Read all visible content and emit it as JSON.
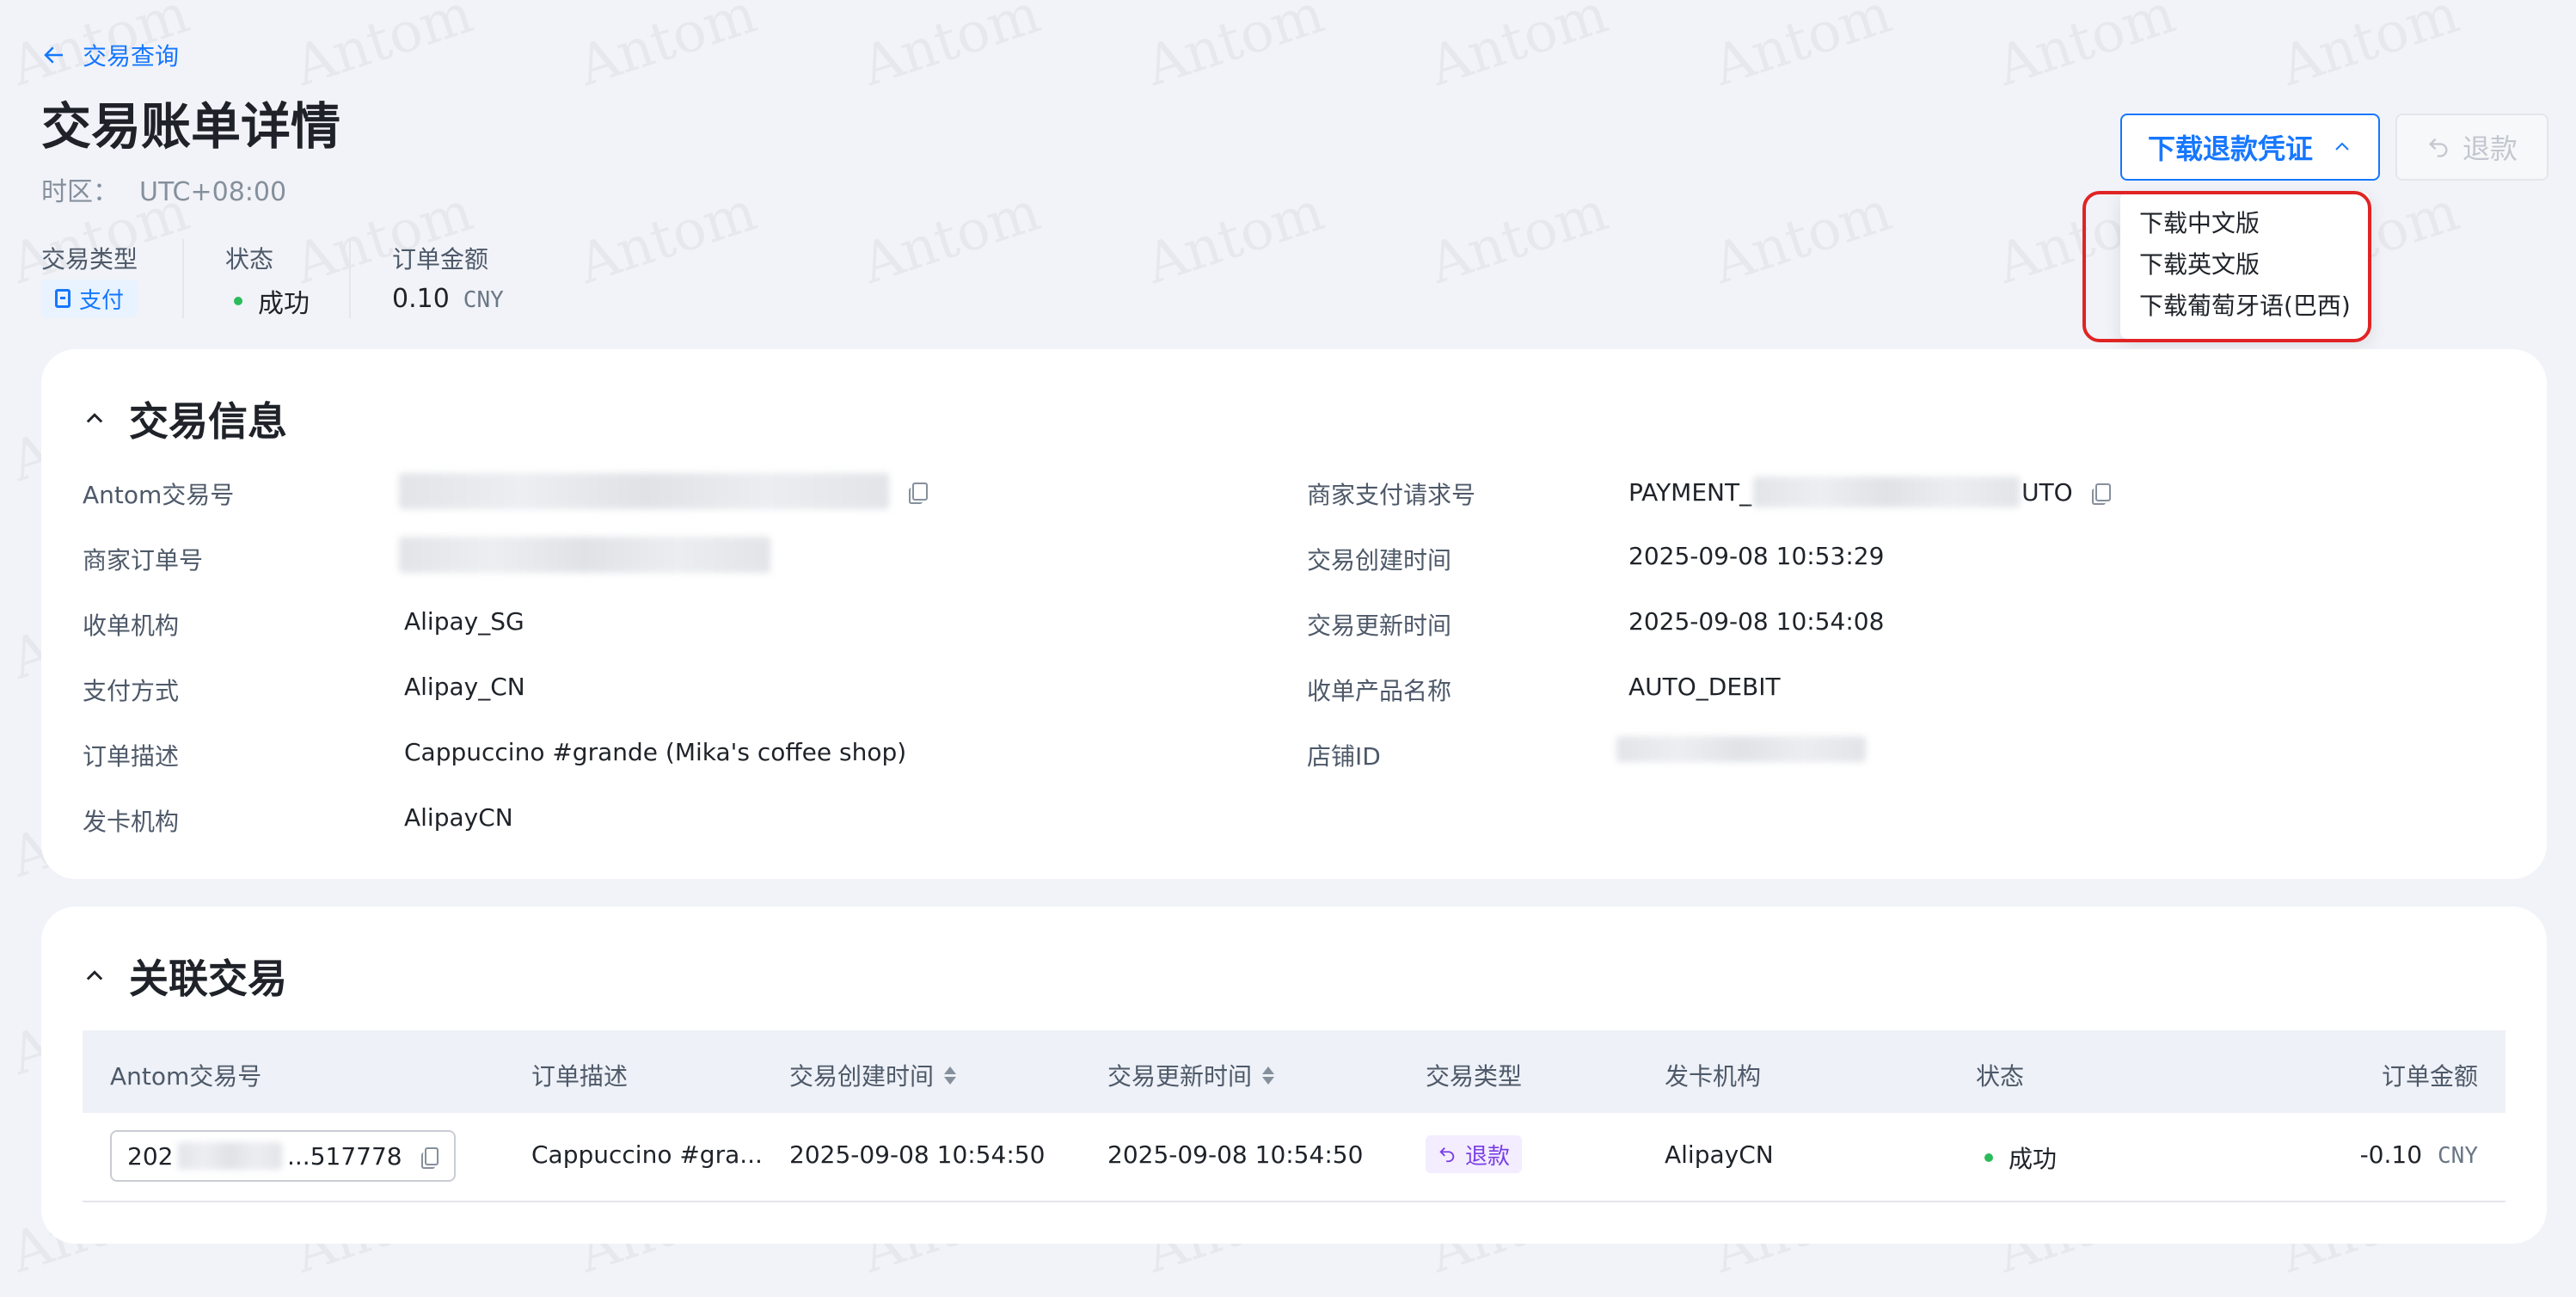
{
  "watermark": {
    "text": "Antom"
  },
  "header": {
    "back_label": "交易查询",
    "title": "交易账单详情",
    "timezone_label": "时区：",
    "timezone_value": "UTC+08:00"
  },
  "summary": {
    "type_label": "交易类型",
    "type_value": "支付",
    "status_label": "状态",
    "status_value": "成功",
    "amount_label": "订单金额",
    "amount_value": "0.10",
    "amount_currency": "CNY"
  },
  "actions": {
    "download_label": "下载退款凭证",
    "refund_label": "退款",
    "download_options": [
      "下载中文版",
      "下载英文版",
      "下载葡萄牙语(巴西)"
    ]
  },
  "tx_info": {
    "title": "交易信息",
    "left": [
      {
        "label": "Antom交易号",
        "value": ""
      },
      {
        "label": "商家订单号",
        "value": ""
      },
      {
        "label": "收单机构",
        "value": "Alipay_SG"
      },
      {
        "label": "支付方式",
        "value": "Alipay_CN"
      },
      {
        "label": "订单描述",
        "value": "Cappuccino #grande (Mika's coffee shop)"
      },
      {
        "label": "发卡机构",
        "value": "AlipayCN"
      }
    ],
    "right": [
      {
        "label": "商家支付请求号",
        "value_prefix": "PAYMENT_",
        "value_suffix": "UTO"
      },
      {
        "label": "交易创建时间",
        "value": "2025-09-08 10:53:29"
      },
      {
        "label": "交易更新时间",
        "value": "2025-09-08 10:54:08"
      },
      {
        "label": "收单产品名称",
        "value": "AUTO_DEBIT"
      },
      {
        "label": "店铺ID",
        "value": ""
      }
    ]
  },
  "related": {
    "title": "关联交易",
    "columns": [
      "Antom交易号",
      "订单描述",
      "交易创建时间",
      "交易更新时间",
      "交易类型",
      "发卡机构",
      "状态",
      "订单金额"
    ],
    "rows": [
      {
        "id_prefix": "202",
        "id_suffix": "...517778",
        "description": "Cappuccino #gra...",
        "created": "2025-09-08 10:54:50",
        "updated": "2025-09-08 10:54:50",
        "type": "退款",
        "issuer": "AlipayCN",
        "status": "成功",
        "amount": "-0.10",
        "currency": "CNY"
      }
    ]
  },
  "colors": {
    "accent": "#1677ff",
    "success": "#2bbc5a",
    "refund_tag": "#7a3ee6",
    "highlight": "#e02424"
  }
}
